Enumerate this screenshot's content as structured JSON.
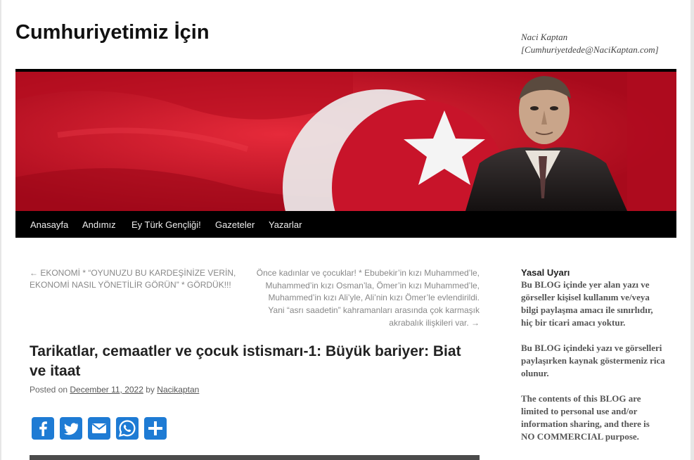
{
  "header": {
    "site_title": "Cumhuriyetimiz İçin",
    "author_name": "Naci Kaptan",
    "author_email": "[Cumhuriyetdede@NaciKaptan.com]"
  },
  "nav": {
    "items": [
      "Anasayfa",
      "Andımız",
      "Ey Türk Gençliği!",
      "Gazeteler",
      "Yazarlar"
    ]
  },
  "post_nav": {
    "previous": "← EKONOMİ * “OYUNUZU BU KARDEŞİNİZE VERİN, EKONOMİ NASIL YÖNETİLİR GÖRÜN” * GÖRDÜK!!!",
    "next": "Önce kadınlar ve çocuklar! * Ebubekir’in kızı Muhammed’le, Muhammed’in kızı Osman’la, Ömer’in kızı Muhammed’le, Muhammed’in kızı Ali’yle, Ali’nin kızı Ömer’le evlendirildi. Yani “asrı saadetin” kahramanları arasında çok karmaşık akrabalık ilişkileri var. →"
  },
  "post": {
    "title": "Tarikatlar, cemaatler ve çocuk istismarı-1: Büyük bariyer: Biat ve itaat",
    "posted_on_label": "Posted on",
    "date": "December 11, 2022",
    "by_label": "by",
    "author": "Nacikaptan"
  },
  "share": {
    "buttons": [
      "facebook-icon",
      "twitter-icon",
      "email-icon",
      "whatsapp-icon",
      "share-icon"
    ],
    "color": "#1e7bd4"
  },
  "sidebar": {
    "title": "Yasal Uyarı",
    "paragraphs": [
      "Bu BLOG içinde yer alan yazı ve görseller kişisel kullanım ve/veya bilgi paylaşma amacı ile sınırlıdır, hiç bir ticari amacı yoktur.",
      "Bu BLOG içindeki yazı ve görselleri paylaşırken kaynak göstermeniz rica olunur.",
      "The contents of this BLOG are limited to personal use and/or information sharing, and there is NO COMMERCIAL purpose."
    ]
  },
  "colors": {
    "nav_bg": "#000000",
    "banner_red": "#c8102a",
    "link_gray": "#888888"
  }
}
